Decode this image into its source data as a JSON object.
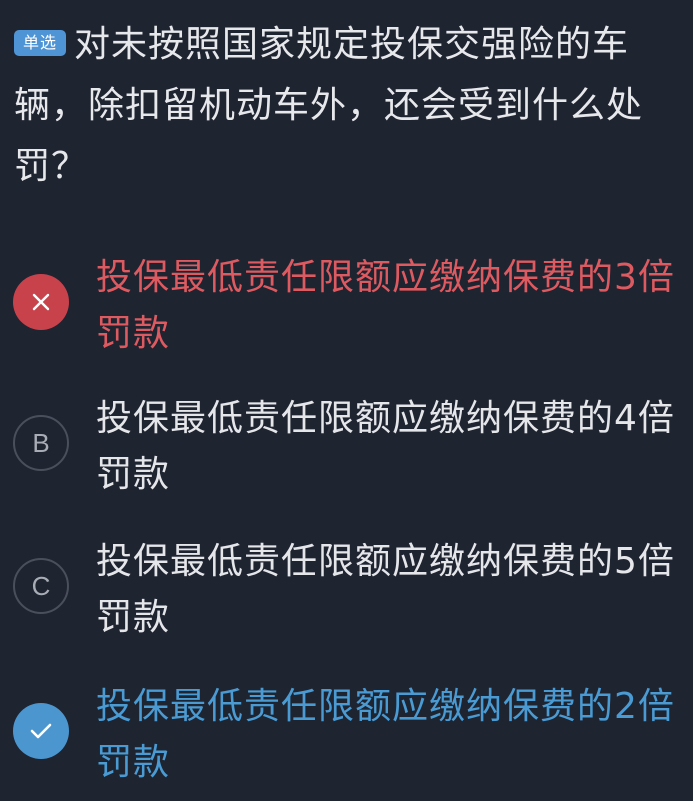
{
  "question": {
    "type_badge": "单选",
    "text": "对未按照国家规定投保交强险的车辆，除扣留机动车外，还会受到什么处罚？"
  },
  "options": [
    {
      "marker": "",
      "marker_icon": "close-icon",
      "status": "wrong",
      "text": "投保最低责任限额应缴纳保费的3倍罚款"
    },
    {
      "marker": "B",
      "status": "normal",
      "text": "投保最低责任限额应缴纳保费的4倍罚款"
    },
    {
      "marker": "C",
      "status": "normal",
      "text": "投保最低责任限额应缴纳保费的5倍罚款"
    },
    {
      "marker": "",
      "marker_icon": "check-icon",
      "status": "correct",
      "text": "投保最低责任限额应缴纳保费的2倍罚款"
    }
  ],
  "colors": {
    "background": "#1f2431",
    "badge": "#4f95d6",
    "wrong": "#dd5a60",
    "correct": "#4a9bd3"
  }
}
